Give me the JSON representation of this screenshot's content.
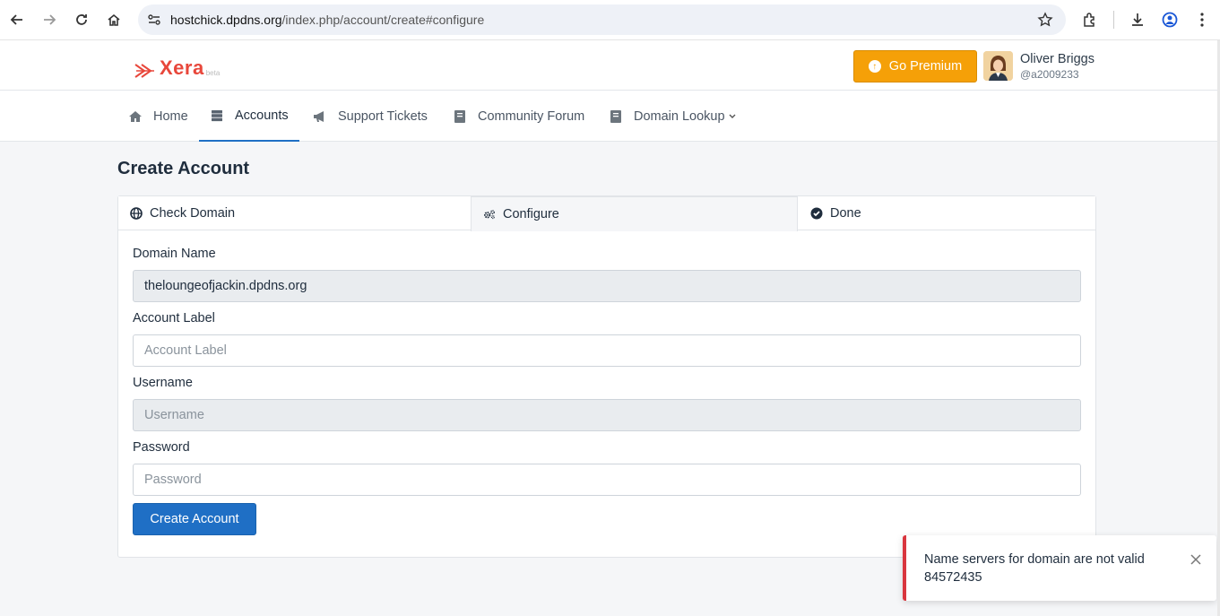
{
  "browser": {
    "url_host": "hostchick.dpdns.org",
    "url_path": "/index.php/account/create#configure",
    "icons": [
      "back-icon",
      "forward-icon",
      "reload-icon",
      "home-icon",
      "site-settings-icon",
      "bookmark-star-icon",
      "extensions-icon",
      "download-icon",
      "profile-icon",
      "menu-icon"
    ]
  },
  "header": {
    "logo_text": "Xera",
    "logo_badge": "beta",
    "premium_label": "Go Premium",
    "user_name": "Oliver Briggs",
    "user_handle": "@a2009233"
  },
  "nav": {
    "items": [
      {
        "label": "Home",
        "icon": "home-icon"
      },
      {
        "label": "Accounts",
        "icon": "server-icon",
        "active": true
      },
      {
        "label": "Support Tickets",
        "icon": "megaphone-icon"
      },
      {
        "label": "Community Forum",
        "icon": "book-icon"
      },
      {
        "label": "Domain Lookup",
        "icon": "book-icon",
        "has_dropdown": true
      }
    ]
  },
  "page": {
    "title": "Create Account"
  },
  "tabs": [
    {
      "label": "Check Domain",
      "icon": "globe-icon"
    },
    {
      "label": "Configure",
      "icon": "cogs-icon",
      "active": true
    },
    {
      "label": "Done",
      "icon": "check-circle-icon"
    }
  ],
  "form": {
    "domain_label": "Domain Name",
    "domain_value": "theloungeofjackin.dpdns.org",
    "account_label_label": "Account Label",
    "account_label_placeholder": "Account Label",
    "username_label": "Username",
    "username_placeholder": "Username",
    "password_label": "Password",
    "password_placeholder": "Password",
    "submit_label": "Create Account"
  },
  "toast": {
    "message": "Name servers for domain are not valid 84572435"
  },
  "colors": {
    "brand": "#e8473b",
    "premium": "#f5a008",
    "primary": "#1f6fc5",
    "error": "#d9363e"
  }
}
